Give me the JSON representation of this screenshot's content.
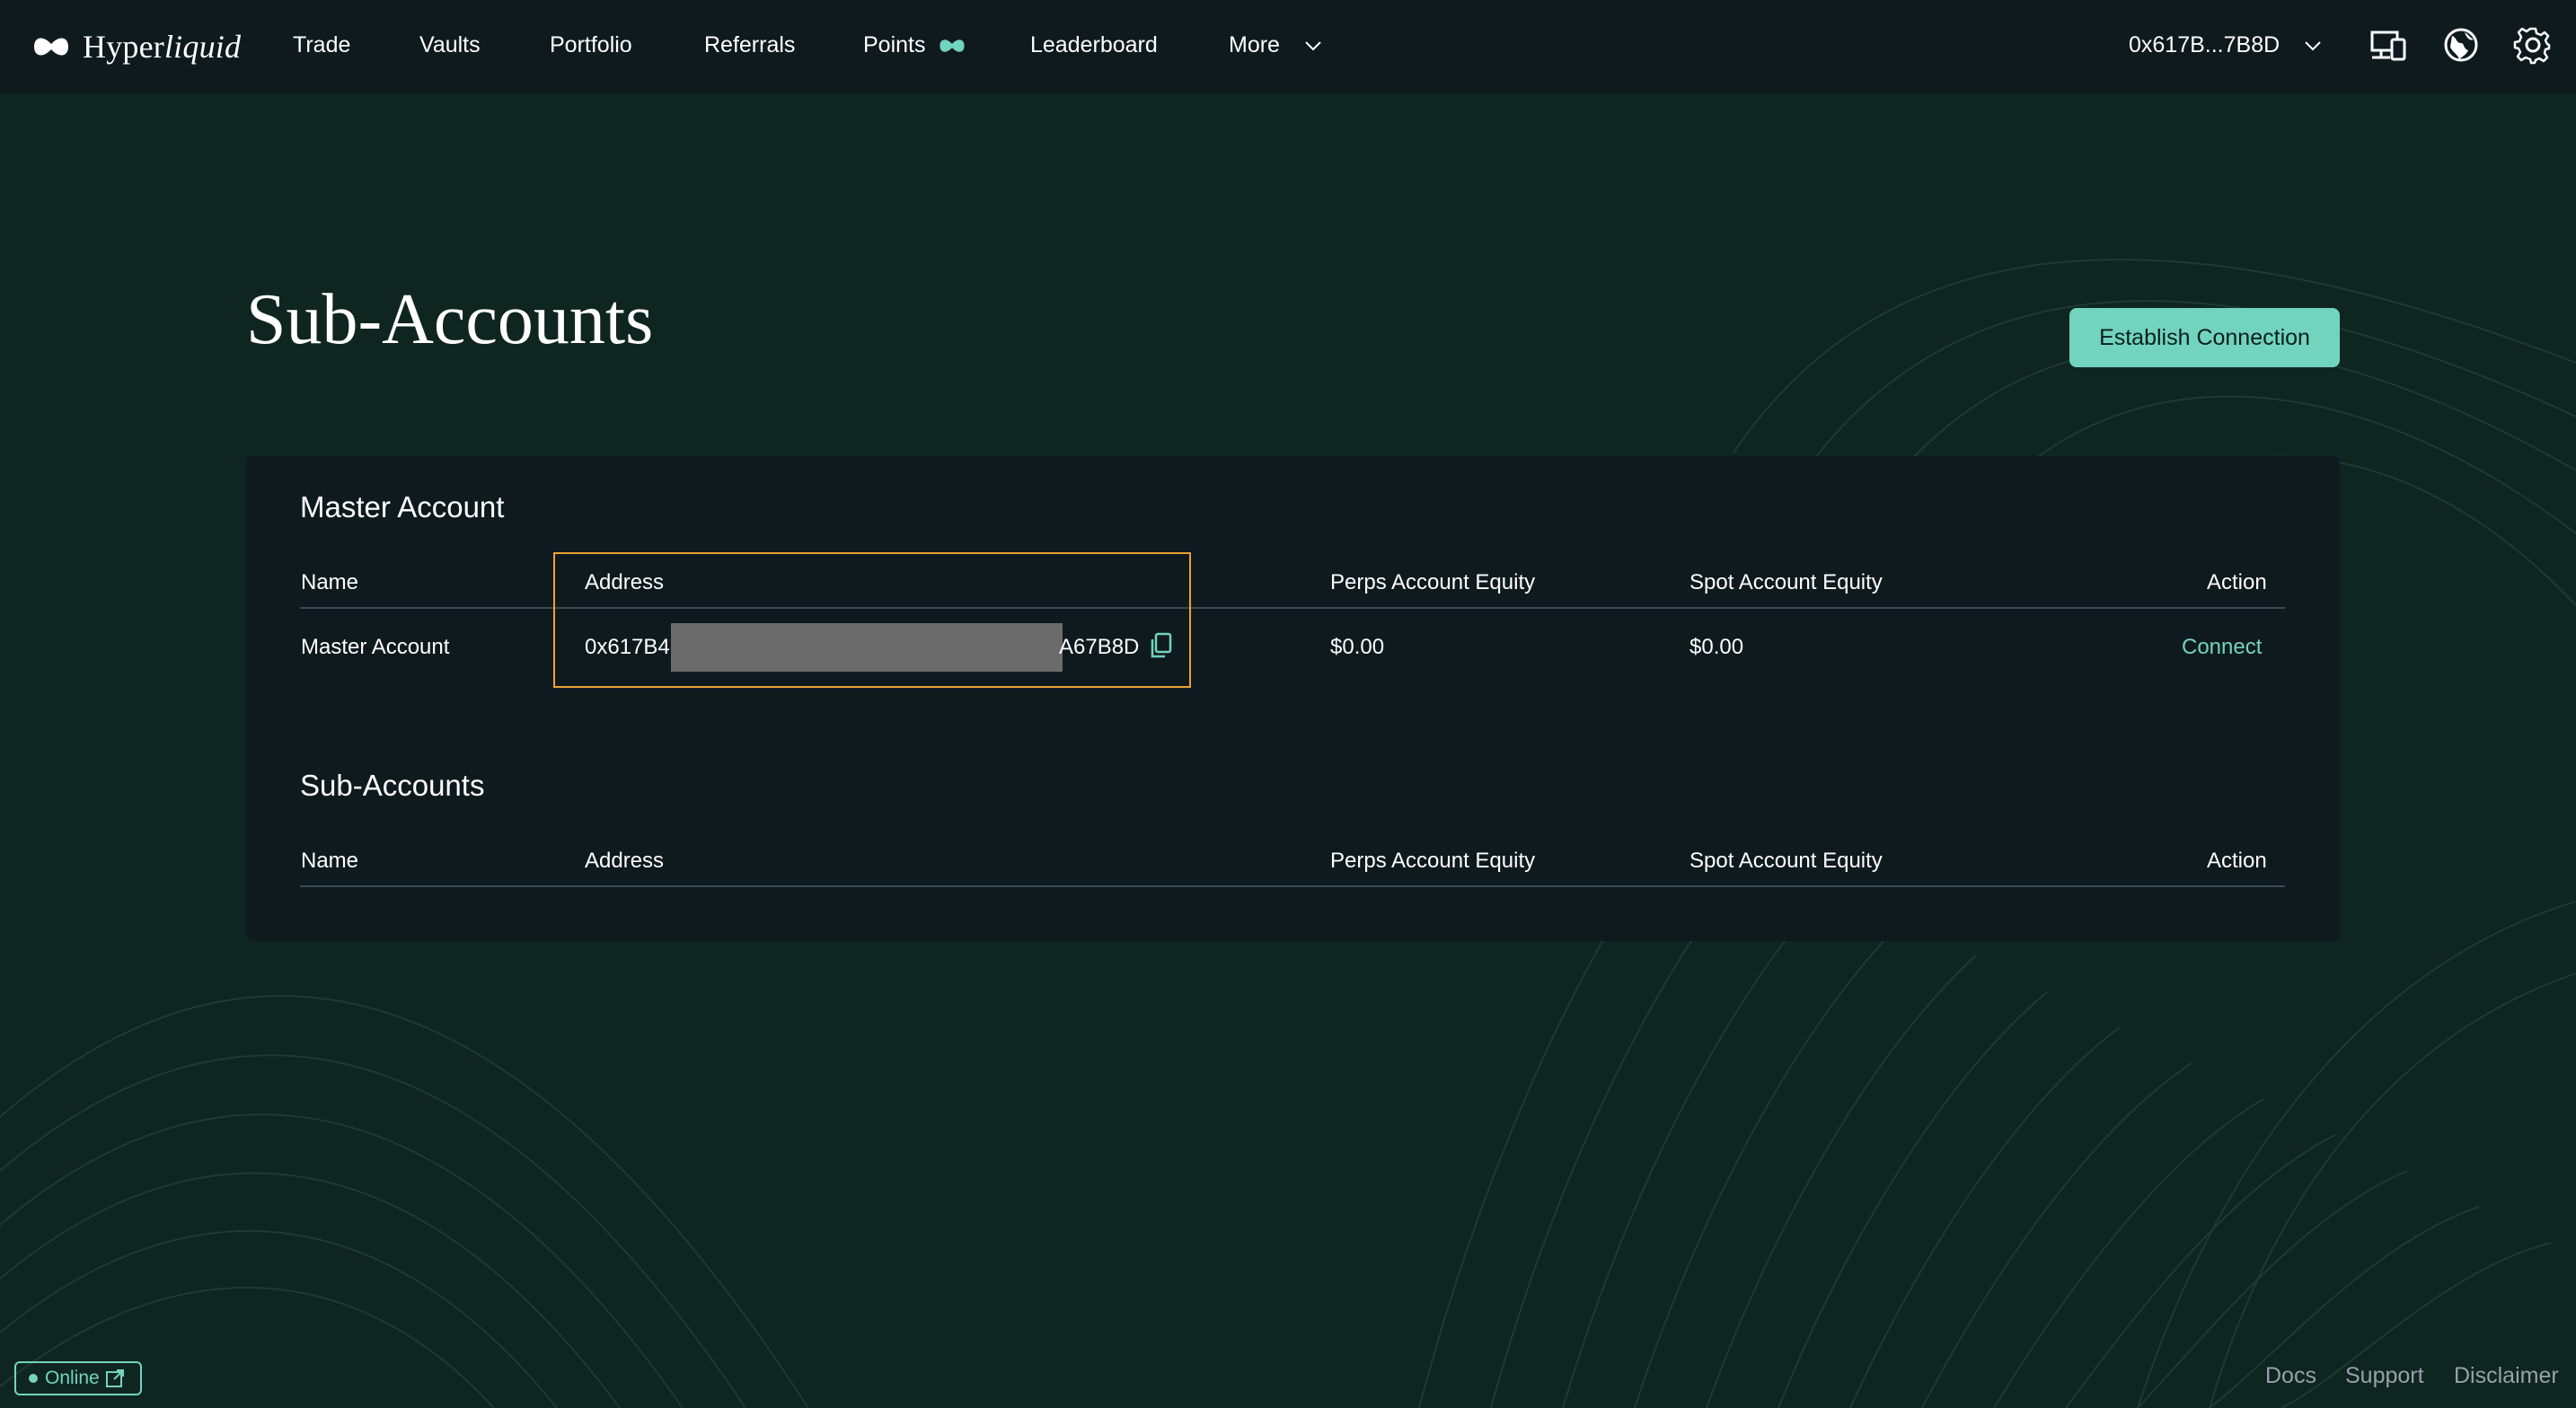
{
  "brand": {
    "name_regular": "Hyper",
    "name_italic": "liquid"
  },
  "nav": {
    "items": [
      {
        "label": "Trade"
      },
      {
        "label": "Vaults"
      },
      {
        "label": "Portfolio"
      },
      {
        "label": "Referrals"
      },
      {
        "label": "Points"
      },
      {
        "label": "Leaderboard"
      },
      {
        "label": "More"
      }
    ],
    "wallet_label": "0x617B...7B8D",
    "icons": [
      "devices-icon",
      "globe-icon",
      "gear-icon"
    ]
  },
  "page": {
    "title": "Sub-Accounts",
    "establish_button": "Establish Connection"
  },
  "master_section": {
    "title": "Master Account",
    "columns": [
      "Name",
      "Address",
      "Perps Account Equity",
      "Spot Account Equity",
      "Action"
    ],
    "row": {
      "name": "Master Account",
      "address_start": "0x617B4",
      "address_end": "A67B8D",
      "perps_equity": "$0.00",
      "spot_equity": "$0.00",
      "action": "Connect"
    }
  },
  "sub_section": {
    "title": "Sub-Accounts",
    "columns": [
      "Name",
      "Address",
      "Perps Account Equity",
      "Spot Account Equity",
      "Action"
    ]
  },
  "footer": {
    "status": "Online",
    "links": [
      "Docs",
      "Support",
      "Disclaimer"
    ]
  },
  "colors": {
    "background": "#0f2520",
    "panel": "#0f1a1f",
    "accent": "#72d3bf",
    "highlight_box": "#f0a030"
  }
}
